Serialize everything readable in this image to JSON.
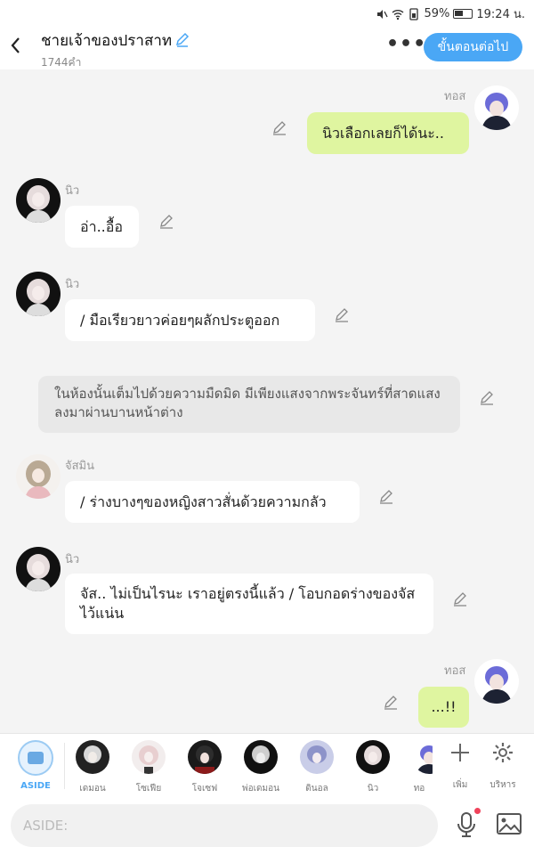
{
  "status": {
    "battery_pct": "59%",
    "time": "19:24 น."
  },
  "header": {
    "title": "ชายเจ้าของปราสาท",
    "subtitle": "1744คำ",
    "next_label": "ขั้นตอนต่อไป",
    "more_label": "•••"
  },
  "messages": [
    {
      "side": "right",
      "name": "ทอส",
      "text": "นิวเลือกเลยก็ได้นะ..",
      "avatar": "purple-hair-boy"
    },
    {
      "side": "left",
      "name": "นิว",
      "text": "อ่า..อื้อ",
      "avatar": "white-hair-girl"
    },
    {
      "side": "left",
      "name": "นิว",
      "text": "/ มือเรียวยาวค่อยๆผลักประตูออก",
      "avatar": "white-hair-girl"
    },
    {
      "side": "narration",
      "text": "ในห้องนั้นเต็มไปด้วยความมืดมิด มีเพียงแสงจากพระจันทร์ที่สาดแสงลงมาผ่านบานหน้าต่าง"
    },
    {
      "side": "left",
      "name": "จัสมิน",
      "text": "/ ร่างบางๆของหญิงสาวสั่นด้วยความกลัว",
      "avatar": "brown-hair-girl"
    },
    {
      "side": "left",
      "name": "นิว",
      "text": "จัส.. ไม่เป็นไรนะ เราอยู่ตรงนี้แล้ว / โอบกอดร่างของจัสไว้แน่น",
      "avatar": "white-hair-girl"
    },
    {
      "side": "right",
      "name": "ทอส",
      "text": "...!!",
      "avatar": "purple-hair-boy"
    }
  ],
  "charbar": {
    "aside_label": "ASIDE",
    "characters": [
      {
        "name": "เดมอน"
      },
      {
        "name": "โซเฟีย"
      },
      {
        "name": "โจเซฟ"
      },
      {
        "name": "พ่อเดมอน"
      },
      {
        "name": "ดินอล"
      },
      {
        "name": "นิว"
      },
      {
        "name": "ทอ"
      }
    ],
    "add_label": "เพิ่ม",
    "manage_label": "บริหาร"
  },
  "input": {
    "placeholder": "ASIDE:",
    "value": ""
  },
  "colors": {
    "accent": "#4aa7f5",
    "right_bubble": "#dff5a0",
    "narration_bg": "#e8e8e8"
  }
}
